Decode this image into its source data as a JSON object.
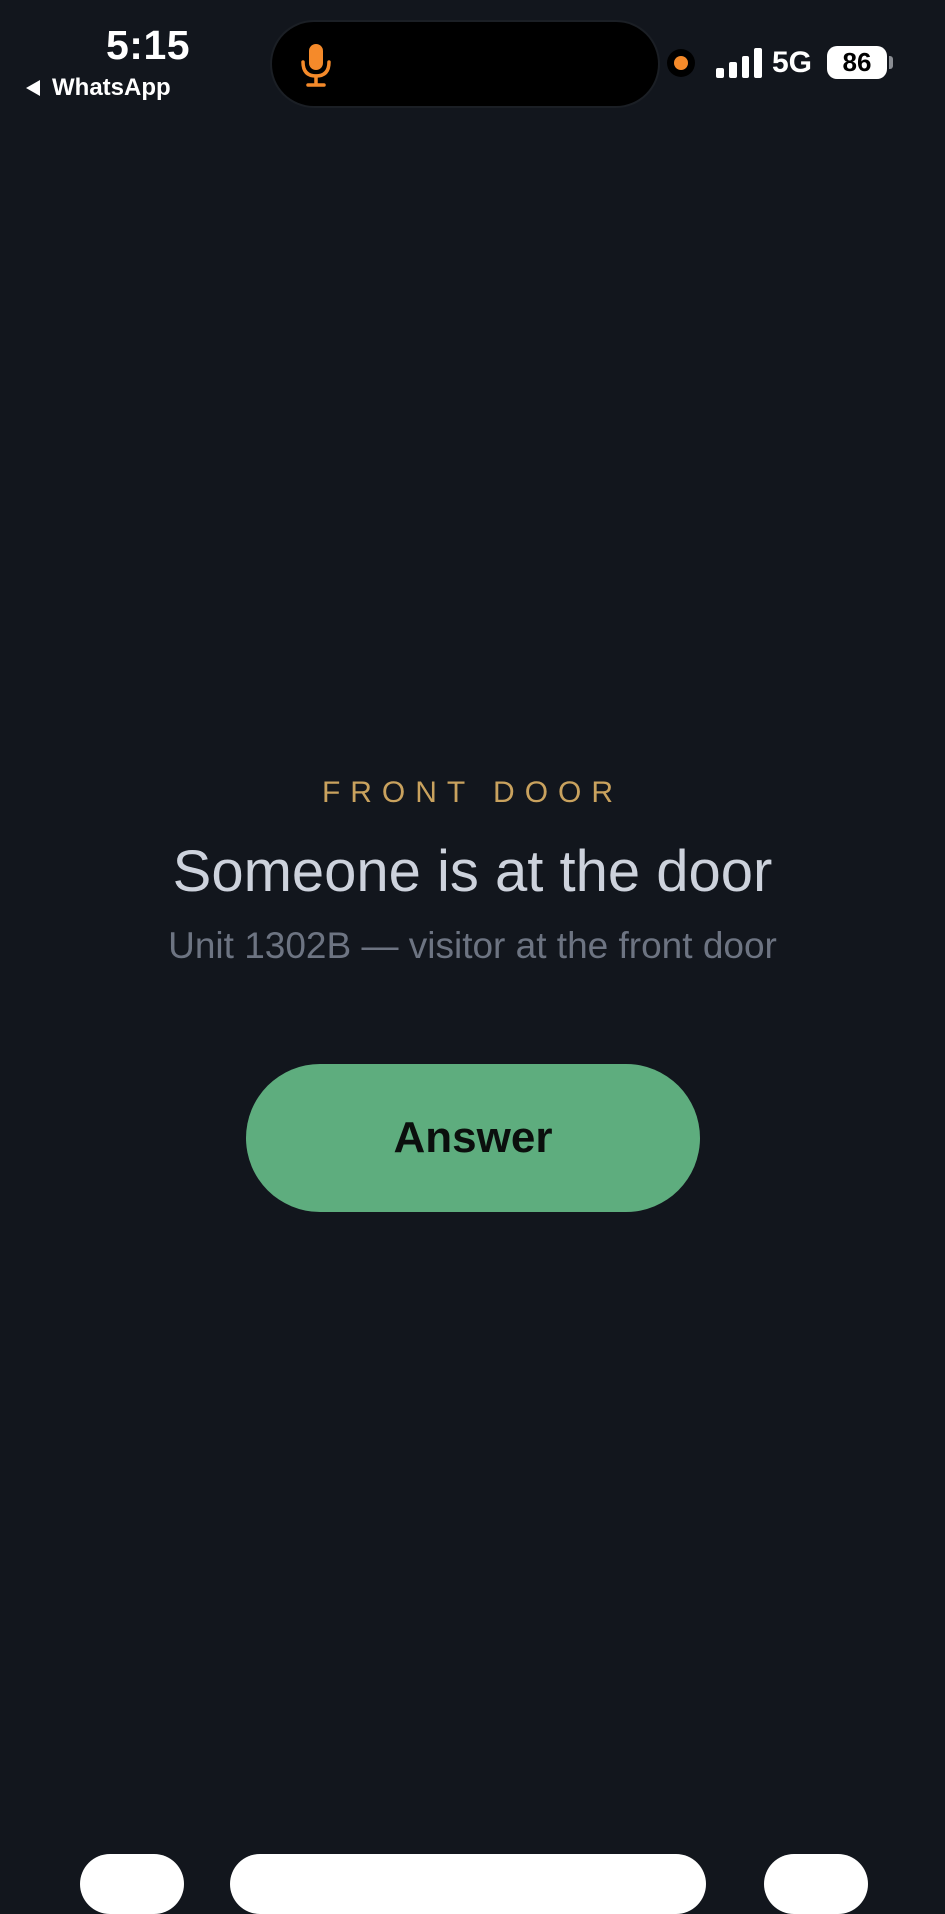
{
  "status_bar": {
    "time": "5:15",
    "back_app": "WhatsApp",
    "network": "5G",
    "battery": "86",
    "mic_color": "#f58a2a",
    "recording_dot_color": "#f58a2a"
  },
  "intercom": {
    "location_label": "FRONT DOOR",
    "title": "Someone is at the door",
    "subtitle": "Unit 1302B — visitor at the front door",
    "answer_label": "Answer"
  },
  "colors": {
    "background": "#12161d",
    "accent_gold": "#c9a25e",
    "answer_green": "#5ead7e",
    "title_text": "#cdd2dc",
    "subtitle_text": "#6d7482"
  }
}
